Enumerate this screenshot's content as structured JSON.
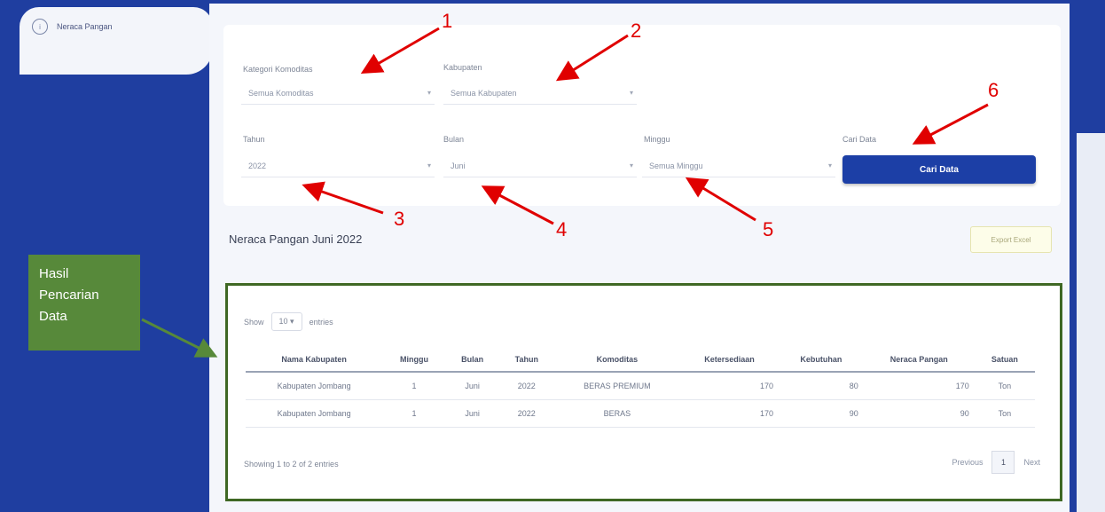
{
  "sidebar": {
    "menu_label": "Neraca Pangan",
    "menu_icon": "info-icon"
  },
  "filters": {
    "kategori": {
      "label": "Kategori Komoditas",
      "value": "Semua Komoditas"
    },
    "kabupaten": {
      "label": "Kabupaten",
      "value": "Semua Kabupaten"
    },
    "tahun": {
      "label": "Tahun",
      "value": "2022"
    },
    "bulan": {
      "label": "Bulan",
      "value": "Juni"
    },
    "minggu": {
      "label": "Minggu",
      "value": "Semua Minggu"
    },
    "cari": {
      "label": "Cari Data",
      "button": "Cari Data"
    }
  },
  "page": {
    "title": "Neraca Pangan Juni 2022",
    "export_label": "Export Excel"
  },
  "results": {
    "show_label": "Show",
    "show_value": "10",
    "entries_label": "entries",
    "columns": [
      "Nama Kabupaten",
      "Minggu",
      "Bulan",
      "Tahun",
      "Komoditas",
      "Ketersediaan",
      "Kebutuhan",
      "Neraca Pangan",
      "Satuan"
    ],
    "rows": [
      [
        "Kabupaten Jombang",
        "1",
        "Juni",
        "2022",
        "BERAS PREMIUM",
        "170",
        "80",
        "170",
        "Ton"
      ],
      [
        "Kabupaten Jombang",
        "1",
        "Juni",
        "2022",
        "BERAS",
        "170",
        "90",
        "90",
        "Ton"
      ]
    ],
    "footer": "Showing 1 to 2 of 2 entries",
    "pager": {
      "previous": "Previous",
      "page": "1",
      "next": "Next"
    }
  },
  "annotations": {
    "markers": [
      "1",
      "2",
      "3",
      "4",
      "5",
      "6"
    ],
    "callout": [
      "Hasil",
      "Pencarian",
      "Data"
    ]
  },
  "colors": {
    "sidebar": "#1f3ea0",
    "primary_button": "#1c3fa6",
    "annotation_red": "#e00000",
    "callout_green": "#57893a"
  }
}
